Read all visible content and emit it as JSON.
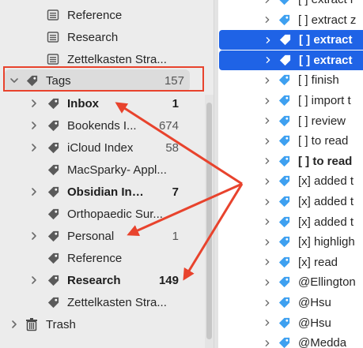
{
  "sidebar": {
    "items": [
      {
        "label": "Reference",
        "icon": "note-icon",
        "level": 2,
        "bold": false,
        "count": "",
        "chevron": false
      },
      {
        "label": "Research",
        "icon": "note-icon",
        "level": 2,
        "bold": false,
        "count": "",
        "chevron": false
      },
      {
        "label": "Zettelkasten Stra...",
        "icon": "note-icon",
        "level": 2,
        "bold": false,
        "count": "",
        "chevron": false
      },
      {
        "label": "Tags",
        "icon": "tag-icon",
        "level": 1,
        "bold": false,
        "count": "157",
        "chevron": true,
        "expanded": true
      },
      {
        "label": "Inbox",
        "icon": "tag-icon",
        "level": 2,
        "bold": true,
        "count": "1",
        "chevron": true
      },
      {
        "label": "Bookends I...",
        "icon": "tag-icon",
        "level": 2,
        "bold": false,
        "count": "674",
        "chevron": true
      },
      {
        "label": "iCloud Index",
        "icon": "tag-icon",
        "level": 2,
        "bold": false,
        "count": "58",
        "chevron": true
      },
      {
        "label": "MacSparky- Appl...",
        "icon": "tag-icon",
        "level": 2,
        "bold": false,
        "count": "",
        "chevron": false
      },
      {
        "label": "Obsidian Index",
        "icon": "tag-icon",
        "level": 2,
        "bold": true,
        "count": "7",
        "chevron": true
      },
      {
        "label": "Orthopaedic Sur...",
        "icon": "tag-icon",
        "level": 2,
        "bold": false,
        "count": "",
        "chevron": false
      },
      {
        "label": "Personal",
        "icon": "tag-icon",
        "level": 2,
        "bold": false,
        "count": "1",
        "chevron": true
      },
      {
        "label": "Reference",
        "icon": "tag-icon",
        "level": 2,
        "bold": false,
        "count": "",
        "chevron": false
      },
      {
        "label": "Research",
        "icon": "tag-icon",
        "level": 2,
        "bold": true,
        "count": "149",
        "chevron": true
      },
      {
        "label": "Zettelkasten Stra...",
        "icon": "tag-icon",
        "level": 2,
        "bold": false,
        "count": "",
        "chevron": false
      },
      {
        "label": "Trash",
        "icon": "trash-icon",
        "level": 1,
        "bold": false,
        "count": "",
        "chevron": true
      }
    ]
  },
  "list": {
    "items": [
      {
        "label": "[ ] extract i",
        "selected": false,
        "bold": false
      },
      {
        "label": "[ ] extract z",
        "selected": false,
        "bold": false
      },
      {
        "label": "[ ] extract",
        "selected": true,
        "bold": true
      },
      {
        "label": "[ ] extract",
        "selected": true,
        "bold": true
      },
      {
        "label": "[ ] finish",
        "selected": false,
        "bold": false
      },
      {
        "label": "[ ] import t",
        "selected": false,
        "bold": false
      },
      {
        "label": "[ ] review",
        "selected": false,
        "bold": false
      },
      {
        "label": "[ ] to read",
        "selected": false,
        "bold": false
      },
      {
        "label": "[ ] to read",
        "selected": false,
        "bold": true
      },
      {
        "label": "[x] added t",
        "selected": false,
        "bold": false
      },
      {
        "label": "[x] added t",
        "selected": false,
        "bold": false
      },
      {
        "label": "[x] added t",
        "selected": false,
        "bold": false
      },
      {
        "label": "[x] highligh",
        "selected": false,
        "bold": false
      },
      {
        "label": "[x] read",
        "selected": false,
        "bold": false
      },
      {
        "label": "@Ellington",
        "selected": false,
        "bold": false
      },
      {
        "label": "@Hsu",
        "selected": false,
        "bold": false
      },
      {
        "label": "@Hsu",
        "selected": false,
        "bold": false
      },
      {
        "label": "@Medda",
        "selected": false,
        "bold": false
      }
    ]
  },
  "colors": {
    "annotation": "#e8432d",
    "selection": "#1f63e6",
    "tag_blue": "#3ea0f0",
    "tag_gray": "#5a5a5a"
  }
}
